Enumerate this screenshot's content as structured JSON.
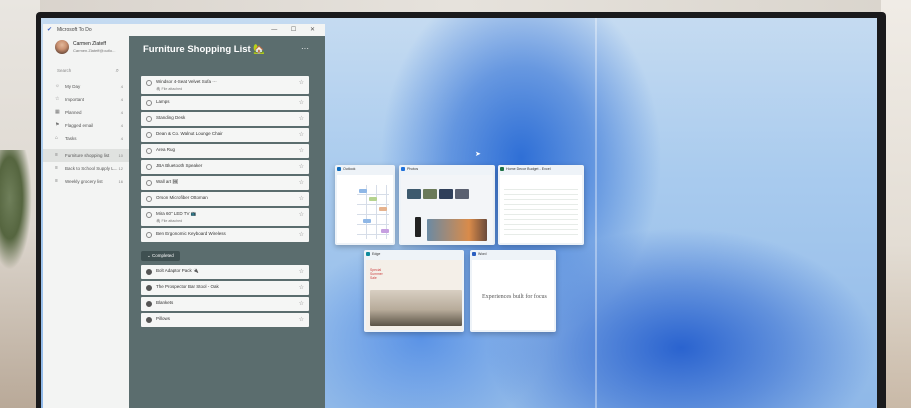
{
  "todo_app": {
    "window_title": "Microsoft To Do",
    "profile": {
      "name": "Carmen Zlateff",
      "email": "Carmen.Zlateff@outlo..."
    },
    "search_placeholder": "Search",
    "nav": [
      {
        "label": "My Day",
        "icon": "sun-icon",
        "count": "4"
      },
      {
        "label": "Important",
        "icon": "star-icon",
        "count": "4"
      },
      {
        "label": "Planned",
        "icon": "calendar-icon",
        "count": "4"
      },
      {
        "label": "Flagged email",
        "icon": "flag-icon",
        "count": "4"
      },
      {
        "label": "Tasks",
        "icon": "home-icon",
        "count": "4"
      },
      {
        "label": "Furniture shopping list",
        "icon": "list-icon",
        "count": "10"
      },
      {
        "label": "Back to School Supply L...",
        "icon": "list-icon",
        "count": "12"
      },
      {
        "label": "Weekly grocery list",
        "icon": "list-icon",
        "count": "16"
      }
    ],
    "list_title": "Furniture Shopping List 🏡",
    "more": "···",
    "tasks": [
      {
        "text": "Windsor 4-Seat Velvet Sofa ⋯",
        "sub": "🖇 File attached"
      },
      {
        "text": "Lamps",
        "sub": ""
      },
      {
        "text": "Standing Desk",
        "sub": ""
      },
      {
        "text": "Dean & Co. Walnut Lounge Chair",
        "sub": ""
      },
      {
        "text": "Area Rug",
        "sub": ""
      },
      {
        "text": "JBA Bluetooth Speaker",
        "sub": ""
      },
      {
        "text": "Wall art 🖼",
        "sub": ""
      },
      {
        "text": "Orson Microfiber Ottoman",
        "sub": ""
      },
      {
        "text": "Mira 60\" LED TV 📺",
        "sub": "🖇 File attached"
      },
      {
        "text": "Ben Ergonomic Keyboard Wireless",
        "sub": ""
      }
    ],
    "completed_label": "Completed",
    "completed": [
      {
        "text": "Bolt Adaptor Pack 🔌"
      },
      {
        "text": "The Prospector Bar Stool - Oak"
      },
      {
        "text": "Blankets"
      },
      {
        "text": "Pillows"
      }
    ]
  },
  "task_view": {
    "thumbs": [
      {
        "title": "Outlook",
        "color": "#0f6cbd"
      },
      {
        "title": "Photos",
        "color": "#1e6fd9"
      },
      {
        "title": "Home Decor Budget - Excel",
        "color": "#1e7145"
      },
      {
        "title": "Edge",
        "color": "#0f8a9c"
      },
      {
        "title": "Word",
        "color": "#2b5ec0"
      }
    ],
    "edge_banner": "Special Summer Sale",
    "word_heading": "Experiences built for focus"
  },
  "colors": {
    "list_pane": "#5b6d6e",
    "accent": "#0f6cbd"
  }
}
